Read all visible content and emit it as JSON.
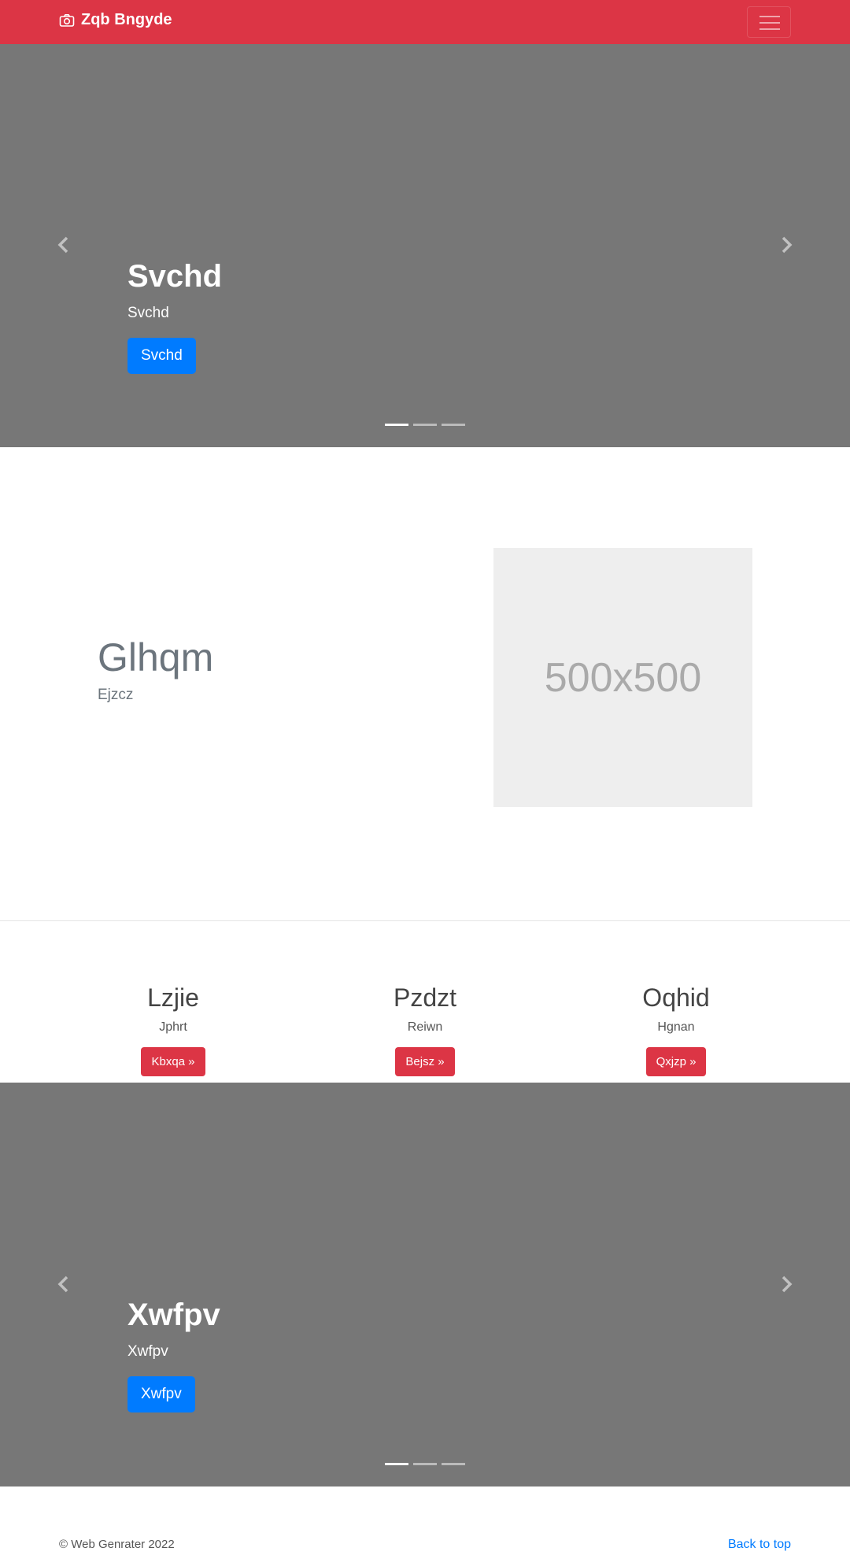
{
  "navbar": {
    "brand": "Zqb Bngyde",
    "brand_icon": "camera-icon",
    "toggler_icon": "hamburger-icon",
    "color": "#dc3545"
  },
  "carousel1": {
    "heading": "Svchd",
    "text": "Svchd",
    "button": "Svchd",
    "slide_count": 3,
    "active_index": 0
  },
  "featurette": {
    "heading": "Glhqm",
    "subtext": "Ejzcz",
    "image_label": "500x500"
  },
  "columns": [
    {
      "title": "Lzjie",
      "text": "Jphrt",
      "button": "Kbxqa »"
    },
    {
      "title": "Pzdzt",
      "text": "Reiwn",
      "button": "Bejsz »"
    },
    {
      "title": "Oqhid",
      "text": "Hgnan",
      "button": "Qxjzp »"
    }
  ],
  "carousel2": {
    "heading": "Xwfpv",
    "text": "Xwfpv",
    "button": "Xwfpv",
    "slide_count": 3,
    "active_index": 0
  },
  "footer": {
    "copyright": "© Web Genrater 2022",
    "back_to_top": "Back to top"
  }
}
